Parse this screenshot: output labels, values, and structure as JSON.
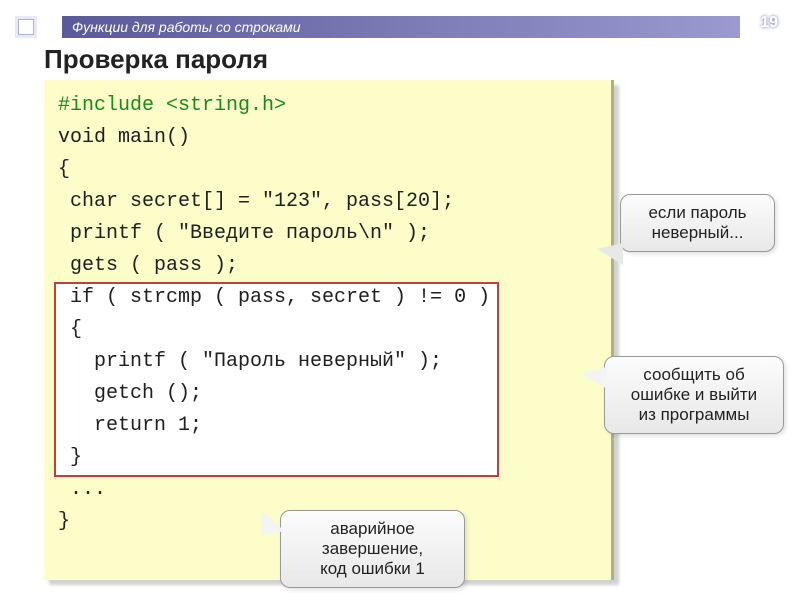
{
  "header": {
    "section_title": "Функции для работы со строками",
    "page_number": "19"
  },
  "slide": {
    "title": "Проверка пароля"
  },
  "code": {
    "lines": [
      "#include <string.h>",
      "void main()",
      "{",
      " char secret[] = \"123\", pass[20];",
      " printf ( \"Введите пароль\\n\" );",
      " gets ( pass );",
      " if ( strcmp ( pass, secret ) != 0 )",
      " {",
      "   printf ( \"Пароль неверный\" );",
      "   getch ();",
      "   return 1;",
      " }",
      " ...",
      "}"
    ]
  },
  "callouts": {
    "c1_line1": "если пароль",
    "c1_line2": "неверный...",
    "c2_line1": "сообщить об",
    "c2_line2": "ошибке и выйти",
    "c2_line3": "из программы",
    "c3_line1": "аварийное",
    "c3_line2": "завершение,",
    "c3_line3": "код ошибки 1"
  }
}
